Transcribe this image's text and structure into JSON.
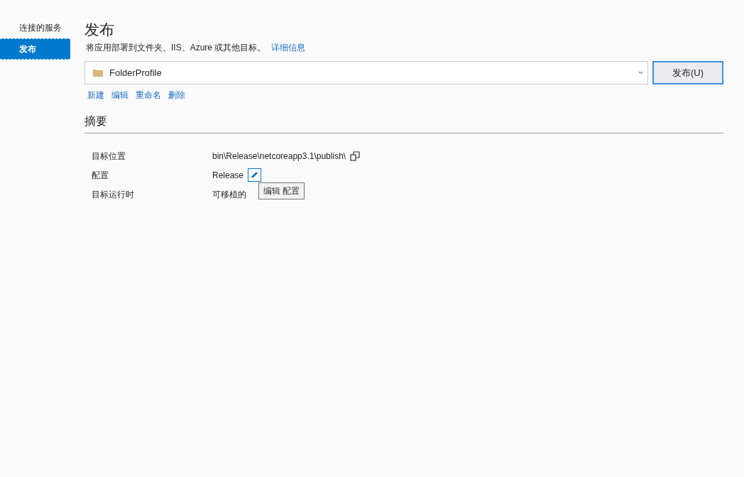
{
  "sidebar": {
    "items": [
      {
        "label": "连接的服务",
        "selected": false
      },
      {
        "label": "发布",
        "selected": true
      }
    ]
  },
  "header": {
    "title": "发布",
    "description": "将应用部署到文件夹、IIS、Azure 或其他目标。",
    "link": "详细信息"
  },
  "profile": {
    "value": "FolderProfile",
    "button": "发布(U)"
  },
  "actions": [
    "新建",
    "编辑",
    "重命名",
    "删除"
  ],
  "summary": {
    "title": "摘要",
    "rows": [
      {
        "label": "目标位置",
        "value": "bin\\Release\\netcoreapp3.1\\publish\\",
        "kind": "copy"
      },
      {
        "label": "配置",
        "value": "Release",
        "kind": "edit"
      },
      {
        "label": "目标运行时",
        "value": "可移植的",
        "kind": "plain"
      }
    ]
  },
  "tooltip": "编辑 配置"
}
